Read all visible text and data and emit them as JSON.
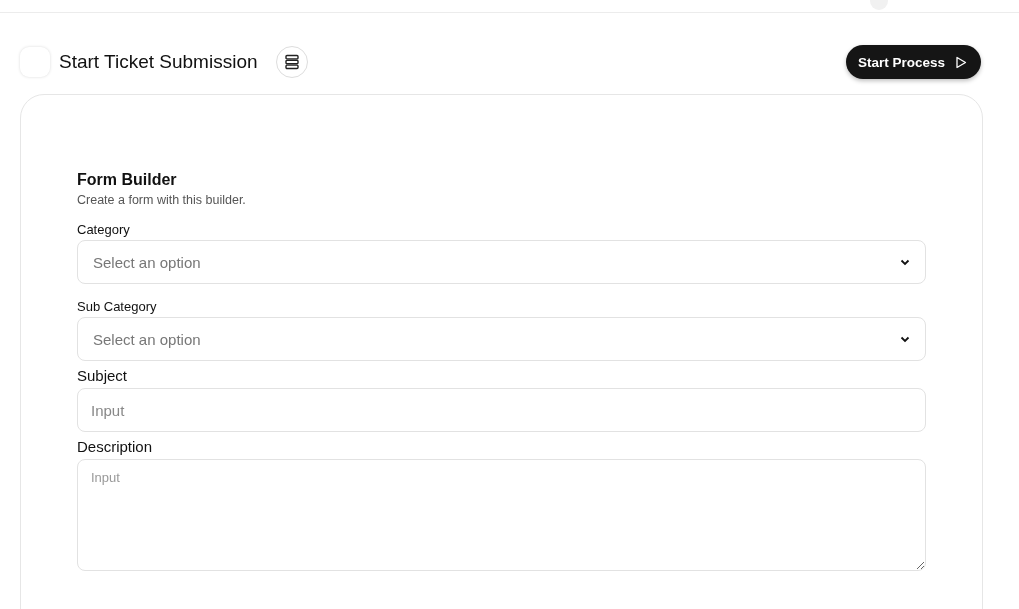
{
  "header": {
    "title": "Start Ticket Submission",
    "action": "Start Process"
  },
  "form": {
    "title": "Form Builder",
    "subtitle": "Create a form with this builder.",
    "fields": [
      {
        "kind": "select",
        "label": "Category",
        "placeholder": "Select an option"
      },
      {
        "kind": "select",
        "label": "Sub Category",
        "placeholder": "Select an option"
      },
      {
        "kind": "input",
        "label": "Subject",
        "placeholder": "Input"
      },
      {
        "kind": "textarea",
        "label": "Description",
        "placeholder": "Input"
      }
    ]
  }
}
